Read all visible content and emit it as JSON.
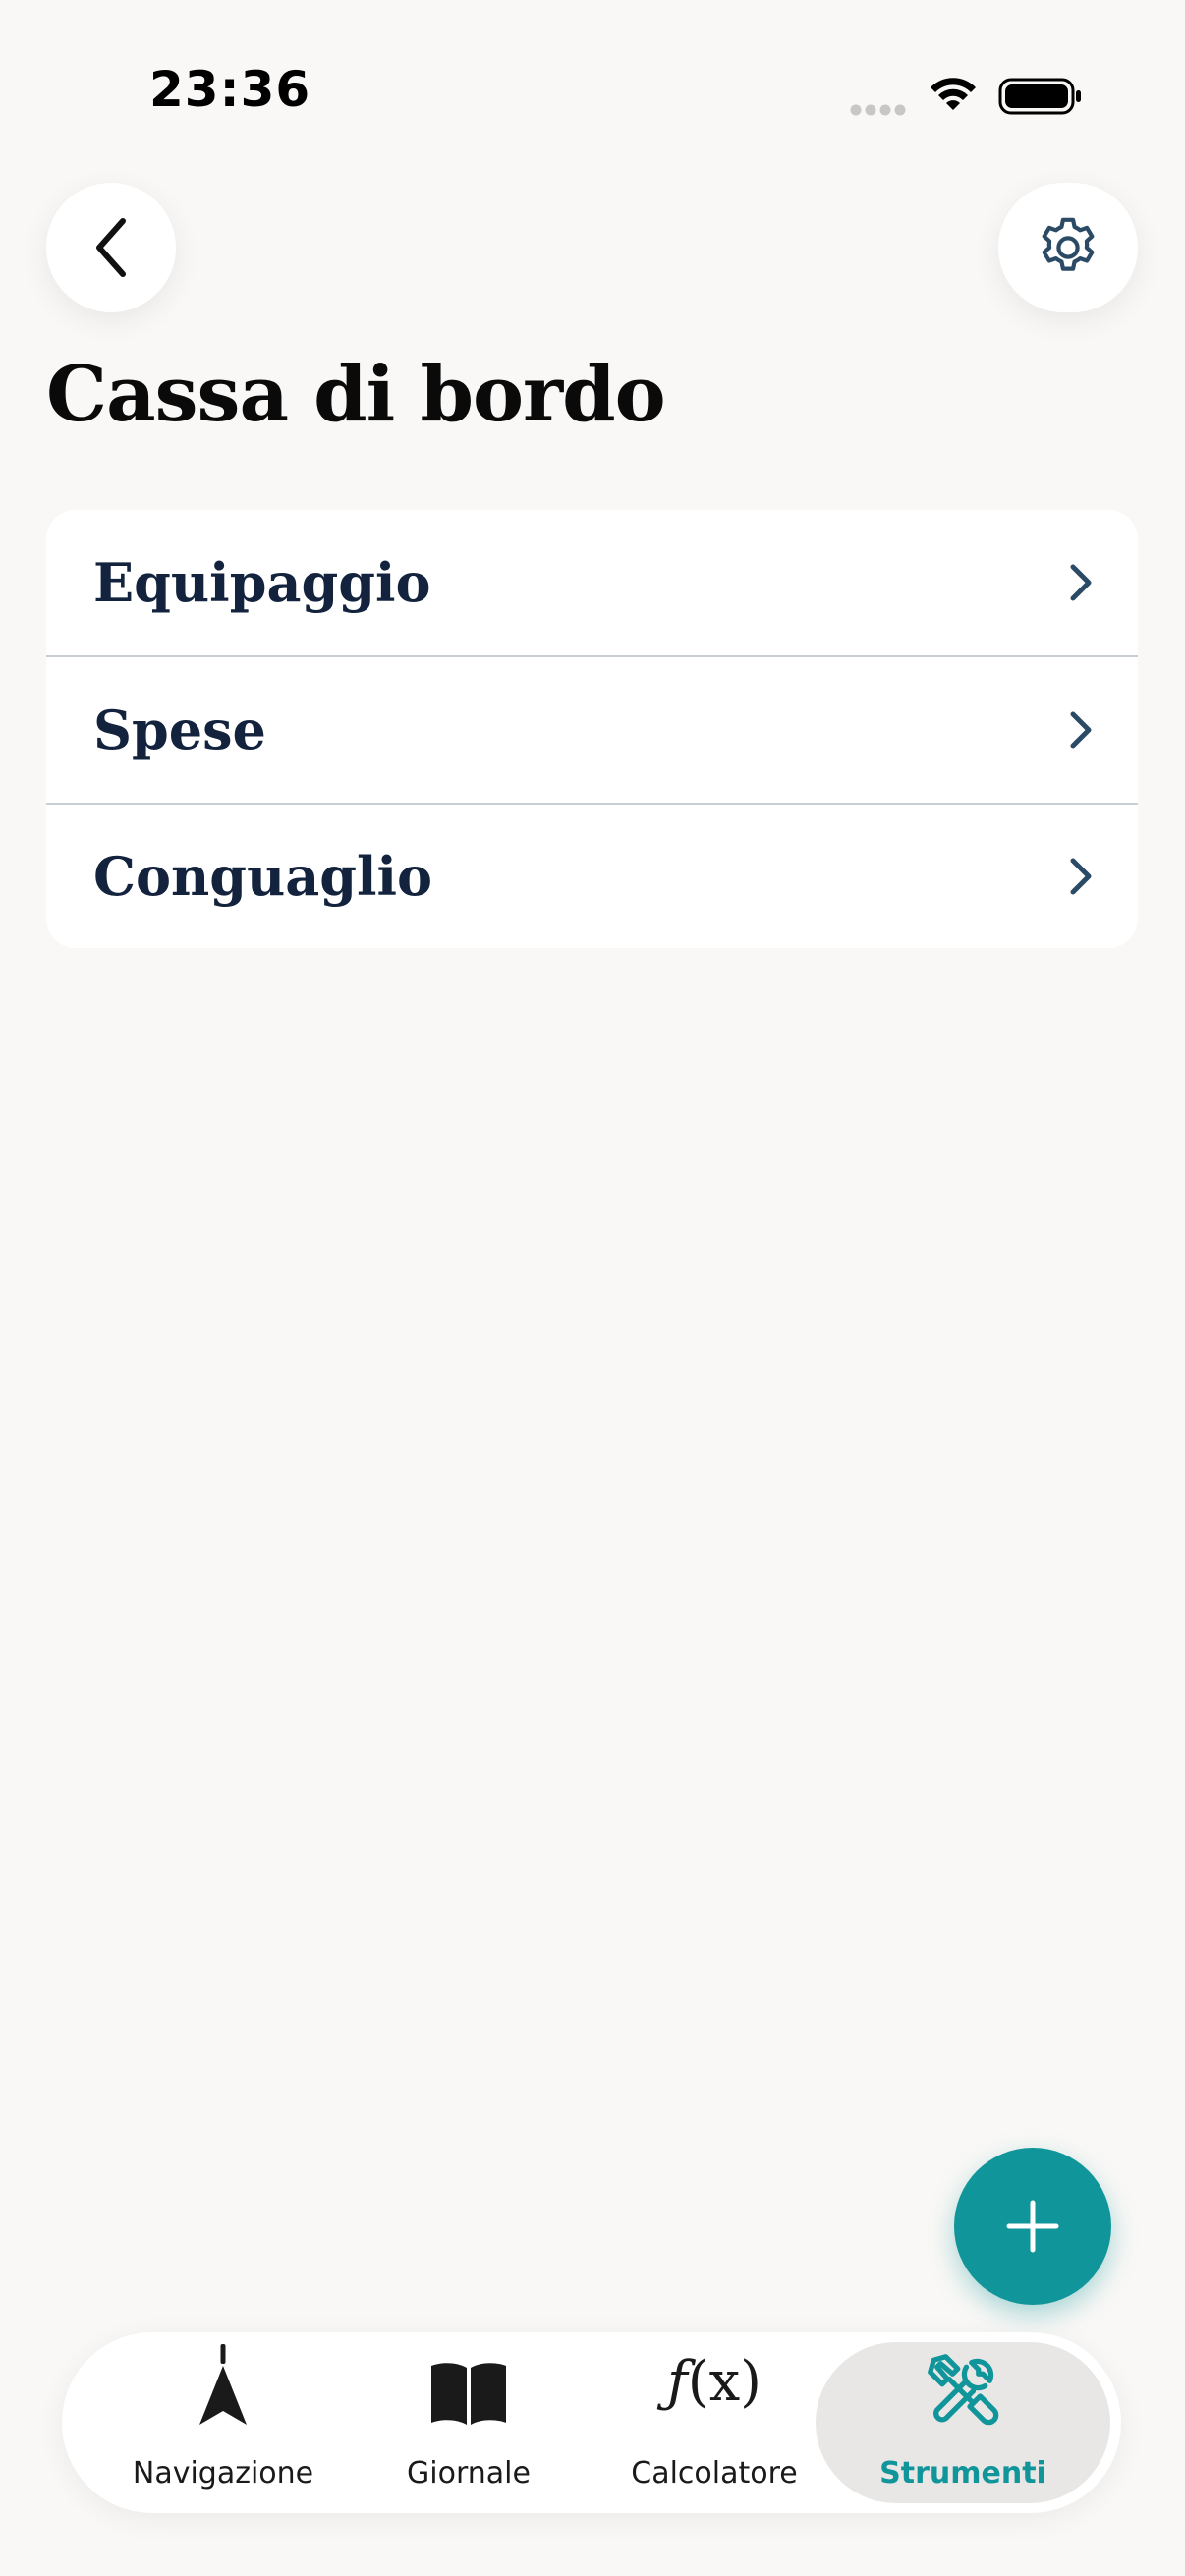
{
  "status_bar": {
    "time": "23:36"
  },
  "header": {
    "back_icon": "chevron-left-icon",
    "settings_icon": "gear-icon",
    "title": "Cassa di bordo"
  },
  "menu": {
    "items": [
      {
        "label": "Equipaggio",
        "icon": "chevron-right-icon"
      },
      {
        "label": "Spese",
        "icon": "chevron-right-icon"
      },
      {
        "label": "Conguaglio",
        "icon": "chevron-right-icon"
      }
    ]
  },
  "fab": {
    "icon": "plus-icon"
  },
  "tab_bar": {
    "tabs": [
      {
        "label": "Navigazione",
        "icon": "navigation-arrow-icon",
        "active": false
      },
      {
        "label": "Giornale",
        "icon": "book-icon",
        "active": false
      },
      {
        "label": "Calcolatore",
        "icon": "function-icon",
        "active": false
      },
      {
        "label": "Strumenti",
        "icon": "tools-icon",
        "active": true
      }
    ]
  },
  "colors": {
    "background": "#f9f8f6",
    "accent": "#10959a",
    "text_primary": "#13233d",
    "divider": "#c9ced4"
  }
}
